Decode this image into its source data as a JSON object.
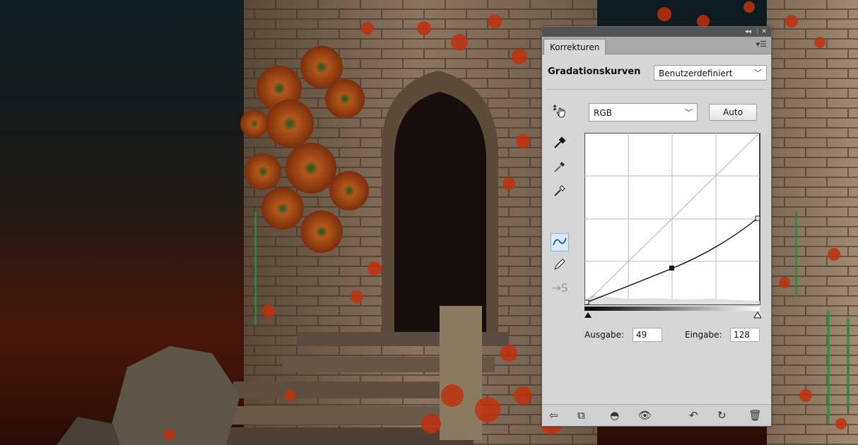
{
  "panel": {
    "tab_label": "Korrekturen",
    "title": "Gradationskurven",
    "preset_value": "Benutzerdefiniert",
    "channel_value": "RGB",
    "auto_label": "Auto",
    "output_label": "Ausgabe:",
    "output_value": "49",
    "input_label": "Eingabe:",
    "input_value": "128"
  },
  "icons": {
    "on_image": "hand-target-adjust-icon",
    "eyedroppers": [
      "black-point-eyedropper-icon",
      "gray-point-eyedropper-icon",
      "white-point-eyedropper-icon"
    ],
    "curve_mode": "curve-point-icon",
    "pencil_mode": "pencil-draw-icon",
    "smooth": "smooth-curve-icon",
    "bottom": [
      "clip-to-layer-icon",
      "view-previous-icon",
      "visibility-eye-icon",
      "reset-icon",
      "trash-icon"
    ]
  }
}
